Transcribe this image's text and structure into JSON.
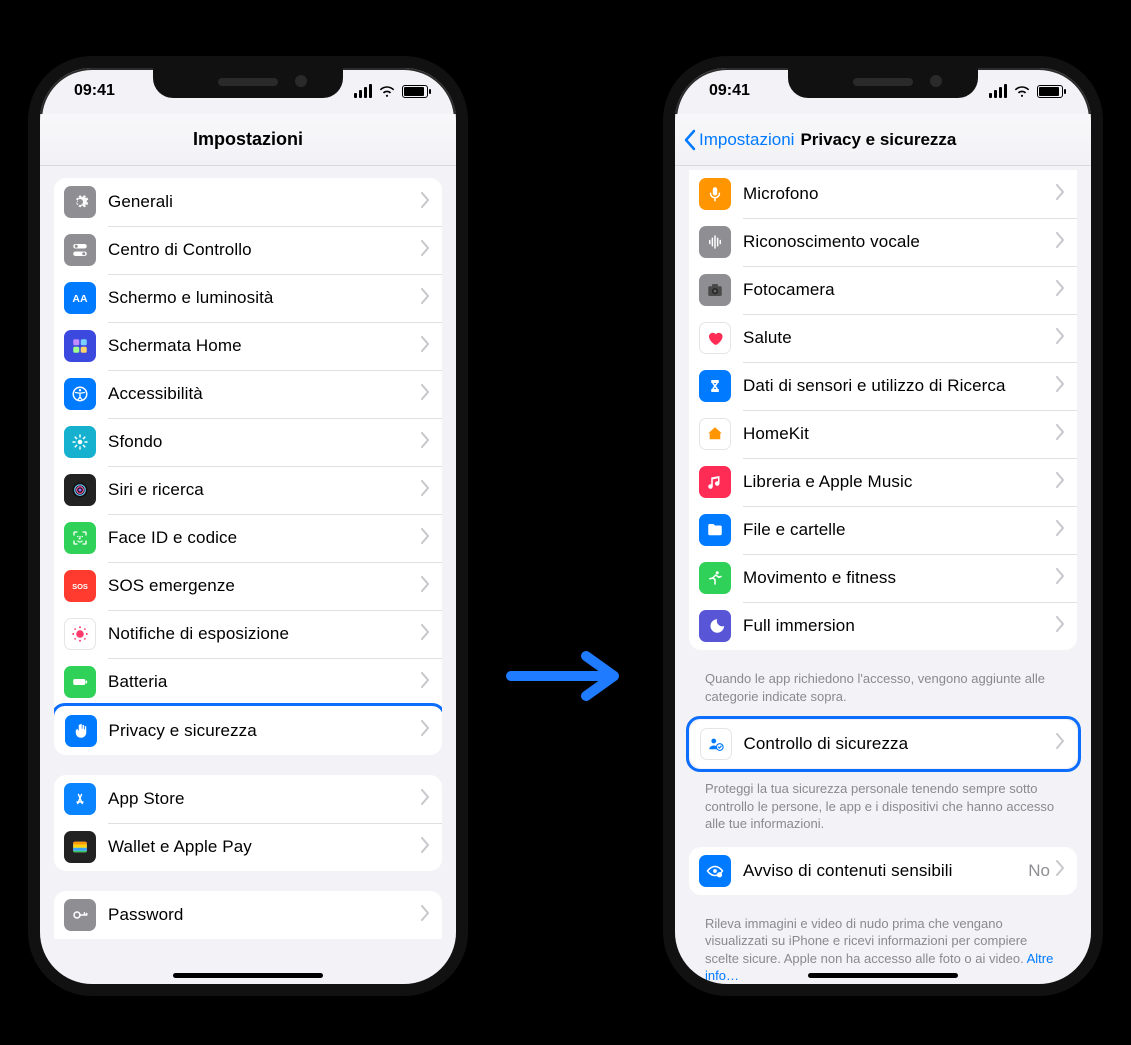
{
  "statusbar": {
    "time": "09:41"
  },
  "left": {
    "title": "Impostazioni",
    "group1": [
      {
        "name": "generali",
        "label": "Generali",
        "icon": "gear",
        "bg": "#8e8e93"
      },
      {
        "name": "centro-di-controllo",
        "label": "Centro di Controllo",
        "icon": "switches",
        "bg": "#8e8e93"
      },
      {
        "name": "schermo-e-luminosita",
        "label": "Schermo e luminosità",
        "icon": "aa",
        "bg": "#007aff"
      },
      {
        "name": "schermata-home",
        "label": "Schermata Home",
        "icon": "grid",
        "bg": "#3b49df"
      },
      {
        "name": "accessibilita",
        "label": "Accessibilità",
        "icon": "access",
        "bg": "#007aff"
      },
      {
        "name": "sfondo",
        "label": "Sfondo",
        "icon": "flower",
        "bg": "#17b1d0"
      },
      {
        "name": "siri-e-ricerca",
        "label": "Siri e ricerca",
        "icon": "siri",
        "bg": "#222"
      },
      {
        "name": "face-id-e-codice",
        "label": "Face ID e codice",
        "icon": "faceid",
        "bg": "#30d158"
      },
      {
        "name": "sos-emergenze",
        "label": "SOS emergenze",
        "icon": "sos",
        "bg": "#ff3b30"
      },
      {
        "name": "notifiche-di-esposizione",
        "label": "Notifiche di esposizione",
        "icon": "exposure",
        "bg": "#fff"
      },
      {
        "name": "batteria",
        "label": "Batteria",
        "icon": "battery",
        "bg": "#30d158"
      },
      {
        "name": "privacy-e-sicurezza",
        "label": "Privacy e sicurezza",
        "icon": "hand",
        "bg": "#007aff",
        "highlight": true
      }
    ],
    "group2": [
      {
        "name": "app-store",
        "label": "App Store",
        "icon": "appstore",
        "bg": "#0a84ff"
      },
      {
        "name": "wallet-e-apple-pay",
        "label": "Wallet e Apple Pay",
        "icon": "wallet",
        "bg": "#222"
      }
    ],
    "group3": [
      {
        "name": "password",
        "label": "Password",
        "icon": "key",
        "bg": "#8e8e93"
      }
    ]
  },
  "right": {
    "back": "Impostazioni",
    "title": "Privacy e sicurezza",
    "group1": [
      {
        "name": "microfono",
        "label": "Microfono",
        "icon": "mic",
        "bg": "#ff9500"
      },
      {
        "name": "riconoscimento-vocale",
        "label": "Riconoscimento vocale",
        "icon": "wave",
        "bg": "#8e8e93"
      },
      {
        "name": "fotocamera",
        "label": "Fotocamera",
        "icon": "camera",
        "bg": "#8e8e93"
      },
      {
        "name": "salute",
        "label": "Salute",
        "icon": "heart",
        "bg": "#fff"
      },
      {
        "name": "dati-di-sensori",
        "label": "Dati di sensori e utilizzo di Ricerca",
        "icon": "sensor",
        "bg": "#007aff"
      },
      {
        "name": "homekit",
        "label": "HomeKit",
        "icon": "home",
        "bg": "#fff"
      },
      {
        "name": "libreria-apple-music",
        "label": "Libreria e Apple Music",
        "icon": "music",
        "bg": "#ff2d55"
      },
      {
        "name": "file-e-cartelle",
        "label": "File e cartelle",
        "icon": "folder",
        "bg": "#007aff"
      },
      {
        "name": "movimento-e-fitness",
        "label": "Movimento e fitness",
        "icon": "runner",
        "bg": "#30d158"
      },
      {
        "name": "full-immersion",
        "label": "Full immersion",
        "icon": "moon",
        "bg": "#5856d6"
      }
    ],
    "footer1": "Quando le app richiedono l'accesso, vengono aggiunte alle categorie indicate sopra.",
    "group2": [
      {
        "name": "controllo-di-sicurezza",
        "label": "Controllo di sicurezza",
        "icon": "safety",
        "bg": "#fff",
        "highlight": true
      }
    ],
    "footer2": "Proteggi la tua sicurezza personale tenendo sempre sotto controllo le persone, le app e i dispositivi che hanno accesso alle tue informazioni.",
    "group3": [
      {
        "name": "avviso-contenuti-sensibili",
        "label": "Avviso di contenuti sensibili",
        "icon": "eye",
        "bg": "#007aff",
        "trail": "No"
      }
    ],
    "footer3_text": "Rileva immagini e video di nudo prima che vengano visualizzati su iPhone e ricevi informazioni per compiere scelte sicure. Apple non ha accesso alle foto o ai video. ",
    "footer3_link": "Altre info…"
  }
}
